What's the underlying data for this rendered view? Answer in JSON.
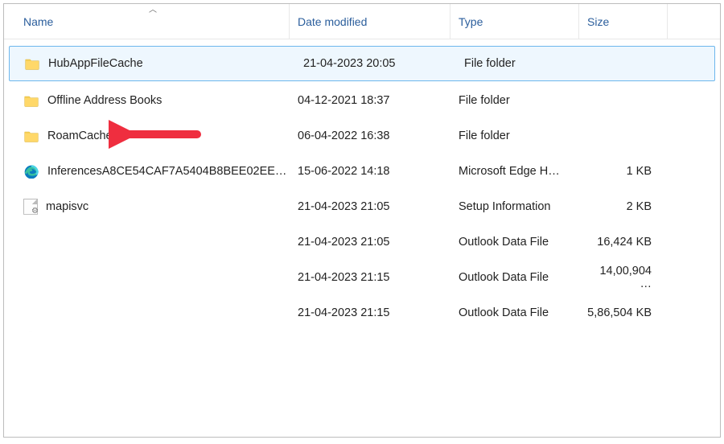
{
  "columns": {
    "name": "Name",
    "date": "Date modified",
    "type": "Type",
    "size": "Size"
  },
  "rows": [
    {
      "icon": "folder",
      "name": "HubAppFileCache",
      "date": "21-04-2023 20:05",
      "type": "File folder",
      "size": "",
      "selected": true
    },
    {
      "icon": "folder",
      "name": "Offline Address Books",
      "date": "04-12-2021 18:37",
      "type": "File folder",
      "size": ""
    },
    {
      "icon": "folder",
      "name": "RoamCache",
      "date": "06-04-2022 16:38",
      "type": "File folder",
      "size": ""
    },
    {
      "icon": "edge",
      "name": "InferencesA8CE54CAF7A5404B8BEE02EE…",
      "date": "15-06-2022 14:18",
      "type": "Microsoft Edge H…",
      "size": "1 KB"
    },
    {
      "icon": "setup",
      "name": "mapisvc",
      "date": "21-04-2023 21:05",
      "type": "Setup Information",
      "size": "2 KB"
    },
    {
      "icon": "blurred",
      "name": "",
      "date": "21-04-2023 21:05",
      "type": "Outlook Data File",
      "size": "16,424 KB"
    },
    {
      "icon": "blurred",
      "name": "",
      "date": "21-04-2023 21:15",
      "type": "Outlook Data File",
      "size": "14,00,904 …"
    },
    {
      "icon": "blurred",
      "name": "",
      "date": "21-04-2023 21:15",
      "type": "Outlook Data File",
      "size": "5,86,504 KB"
    }
  ]
}
